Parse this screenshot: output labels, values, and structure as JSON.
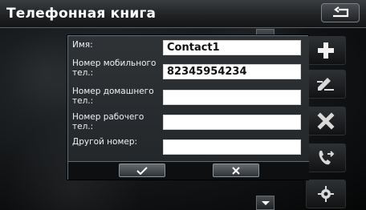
{
  "app": {
    "title": "Телефонная книга"
  },
  "form": {
    "fields": [
      {
        "label": "Имя:",
        "value": "Contact1"
      },
      {
        "label": "Номер мобильного тел.:",
        "value": "82345954234"
      },
      {
        "label": "Номер домашнего тел.:",
        "value": ""
      },
      {
        "label": "Номер рабочего тел.:",
        "value": ""
      },
      {
        "label": "Другой номер:",
        "value": ""
      }
    ]
  },
  "buttons": {
    "confirm_icon": "check-icon",
    "cancel_icon": "x-icon"
  },
  "sidebar": {
    "actions": [
      {
        "icon": "plus-icon"
      },
      {
        "icon": "edit-icon"
      },
      {
        "icon": "delete-icon"
      },
      {
        "icon": "phone-forward-icon"
      },
      {
        "icon": "gear-icon"
      }
    ]
  },
  "colors": {
    "header_text": "#ffffff",
    "field_background": "#ffffff",
    "dialog_border": "#67727a"
  }
}
